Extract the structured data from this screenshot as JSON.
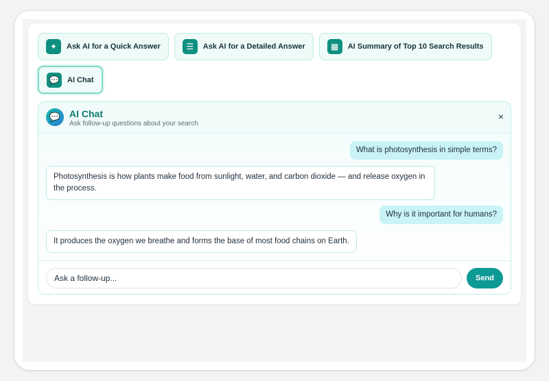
{
  "toolbar": {
    "buttons": [
      {
        "label": "Ask AI for a Quick Answer",
        "icon": "sparkle-icon",
        "glyph": "✦"
      },
      {
        "label": "Ask AI for a Detailed Answer",
        "icon": "list-icon",
        "glyph": "☰"
      },
      {
        "label": "AI Summary of Top 10 Search Results",
        "icon": "summary-icon",
        "glyph": "▦"
      },
      {
        "label": "AI Chat",
        "icon": "chat-icon",
        "glyph": "💬",
        "active": true
      }
    ]
  },
  "chat": {
    "title": "AI Chat",
    "subtitle": "Ask follow-up questions about your search",
    "avatar_glyph": "💬",
    "close_glyph": "×",
    "messages": [
      {
        "role": "user",
        "text": "What is photosynthesis in simple terms?"
      },
      {
        "role": "ai",
        "text": "Photosynthesis is how plants make food from sunlight, water, and carbon dioxide — and release oxygen in the process."
      },
      {
        "role": "user",
        "text": "Why is it important for humans?"
      },
      {
        "role": "ai",
        "text": "It produces the oxygen we breathe and forms the base of most food chains on Earth."
      }
    ],
    "input": {
      "placeholder": "Ask a follow-up...",
      "value": ""
    },
    "send_label": "Send"
  },
  "colors": {
    "accent": "#0e9a94",
    "icon_bg": "#0f8f80",
    "user_bubble": "#c9f3f6",
    "panel_border": "#bfeee6"
  }
}
